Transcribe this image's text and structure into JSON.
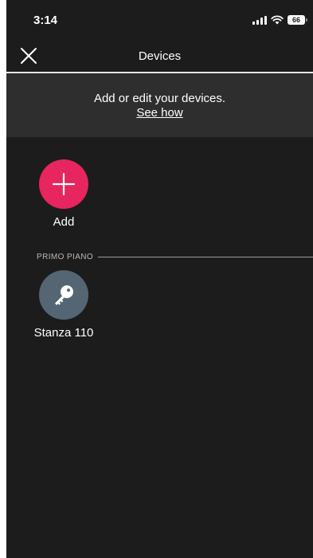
{
  "status_bar": {
    "time": "3:14",
    "battery": "66",
    "icons": [
      "signal-icon",
      "wifi-icon",
      "battery-icon"
    ]
  },
  "nav": {
    "title": "Devices",
    "close_icon": "close-icon"
  },
  "banner": {
    "text": "Add or edit your devices.",
    "link": "See how"
  },
  "add_tile": {
    "label": "Add",
    "icon": "plus-icon",
    "color": "#e7255e"
  },
  "sections": [
    {
      "label": "PRIMO PIANO",
      "devices": [
        {
          "label": "Stanza 110",
          "icon": "key-icon",
          "color": "#546673"
        }
      ]
    }
  ],
  "colors": {
    "background": "#1c1c1c",
    "banner": "#2e2e2e",
    "accent": "#e7255e"
  }
}
